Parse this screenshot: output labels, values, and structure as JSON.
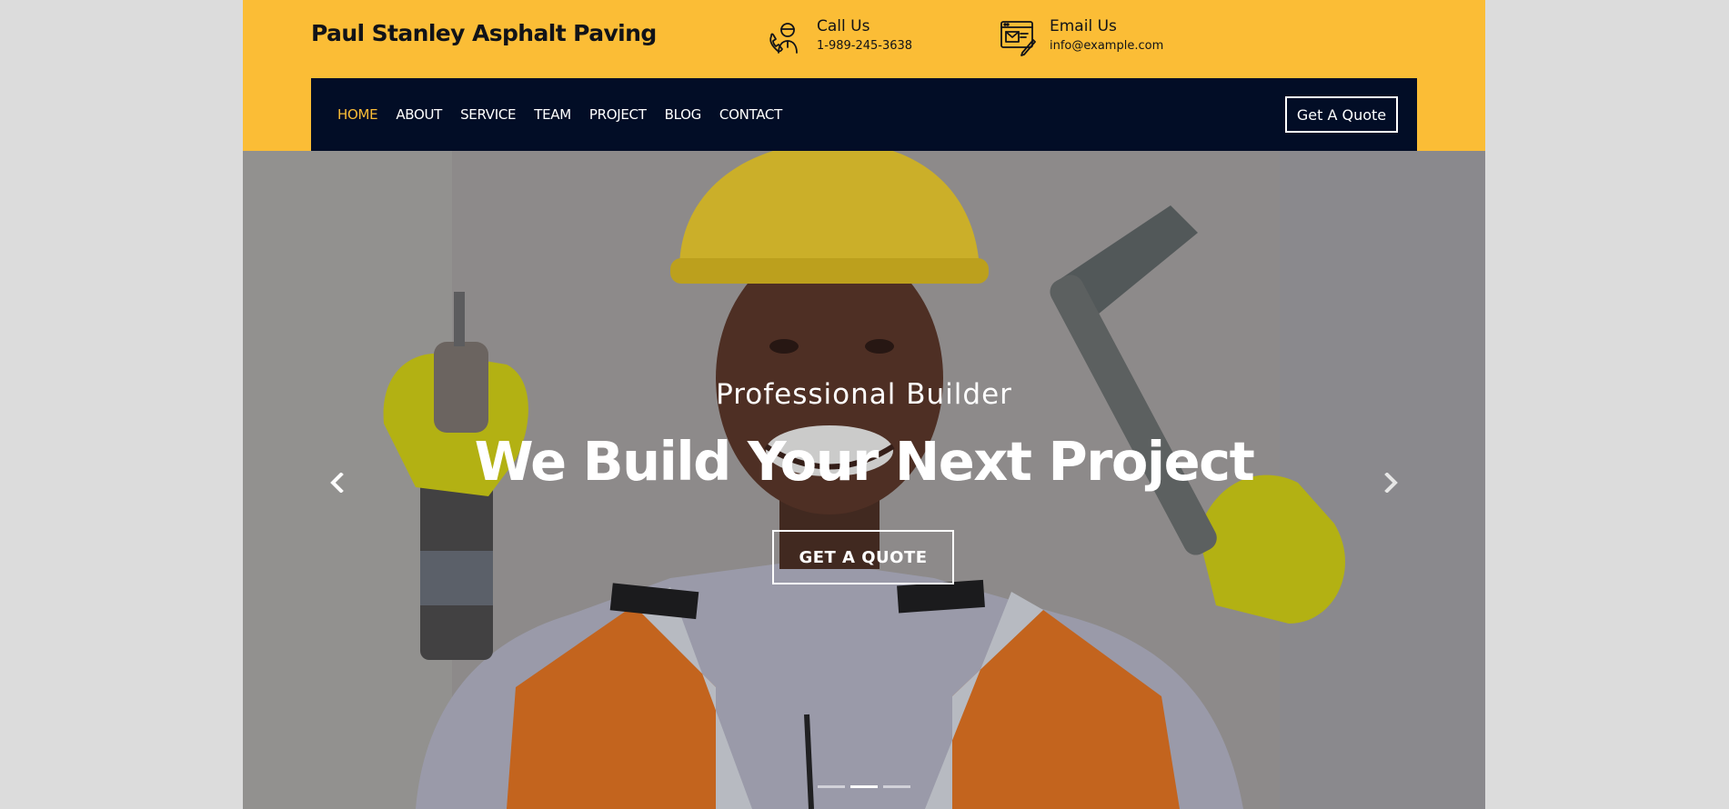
{
  "header": {
    "brand": "Paul Stanley Asphalt Paving",
    "call": {
      "label": "Call Us",
      "value": "1-989-245-3638",
      "icon": "support-agent-icon"
    },
    "email": {
      "label": "Email Us",
      "value": "info@example.com",
      "icon": "email-icon"
    }
  },
  "nav": {
    "items": [
      {
        "label": "HOME",
        "active": true
      },
      {
        "label": "ABOUT"
      },
      {
        "label": "SERVICE"
      },
      {
        "label": "TEAM"
      },
      {
        "label": "PROJECT"
      },
      {
        "label": "BLOG"
      },
      {
        "label": "CONTACT"
      }
    ],
    "quote_button": "Get A Quote"
  },
  "hero": {
    "subtitle": "Professional Builder",
    "title": "We Build Your Next Project",
    "button": "GET A QUOTE",
    "prev_icon": "chevron-left-icon",
    "next_icon": "chevron-right-icon",
    "slides_count": 3,
    "active_slide": 2
  },
  "colors": {
    "accent": "#fbbd36",
    "nav_bg": "#020d26",
    "text_dark": "#111318"
  }
}
